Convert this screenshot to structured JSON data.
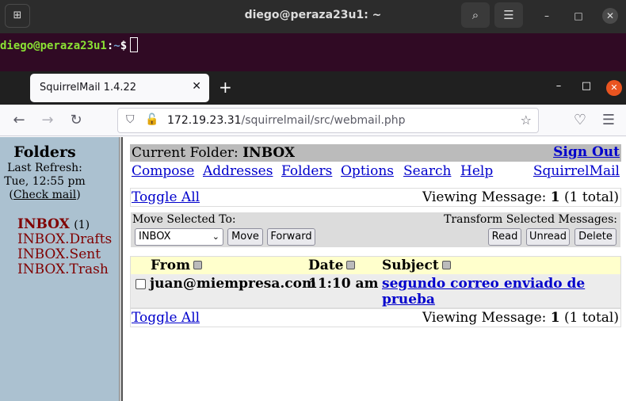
{
  "terminal": {
    "title": "diego@peraza23u1: ~",
    "prompt_user": "diego@peraza23u1",
    "prompt_sep": ":",
    "prompt_path": "~",
    "prompt_sign": "$"
  },
  "browser": {
    "tab_title": "SquirrelMail 1.4.22",
    "url_host": "172.19.23.31",
    "url_path": "/squirrelmail/src/webmail.php"
  },
  "sidebar": {
    "title": "Folders",
    "refresh_label": "Last Refresh:",
    "refresh_time": "Tue, 12:55 pm",
    "check_open": "(",
    "check_mail": "Check mail",
    "check_close": ")",
    "folders": [
      {
        "name": "INBOX",
        "count": "(1)"
      },
      {
        "name": "INBOX.Drafts"
      },
      {
        "name": "INBOX.Sent"
      },
      {
        "name": "INBOX.Trash"
      }
    ]
  },
  "header": {
    "current_folder_label": "Current Folder:",
    "current_folder": "INBOX",
    "sign_out": "Sign Out",
    "menu": [
      "Compose",
      "Addresses",
      "Folders",
      "Options",
      "Search",
      "Help"
    ],
    "brand_link": "SquirrelMail"
  },
  "toolbar": {
    "toggle_all": "Toggle All",
    "viewing_label": "Viewing Message:",
    "viewing_num": "1",
    "viewing_total": "(1 total)",
    "move_label": "Move Selected To:",
    "transform_label": "Transform Selected Messages:",
    "move_target": "INBOX",
    "move_button": "Move",
    "forward_button": "Forward",
    "read_button": "Read",
    "unread_button": "Unread",
    "delete_button": "Delete"
  },
  "messages": {
    "columns": [
      "From",
      "Date",
      "Subject"
    ],
    "rows": [
      {
        "from": "juan@miempresa.com",
        "date": "11:10 am",
        "subject": "segundo correo enviado de prueba"
      }
    ]
  },
  "colors": {
    "terminal_bg": "#300a24",
    "sidebar_bg": "#abc1d0",
    "link": "#0000cc",
    "folder": "#800000",
    "list_header": "#ffffcc"
  }
}
